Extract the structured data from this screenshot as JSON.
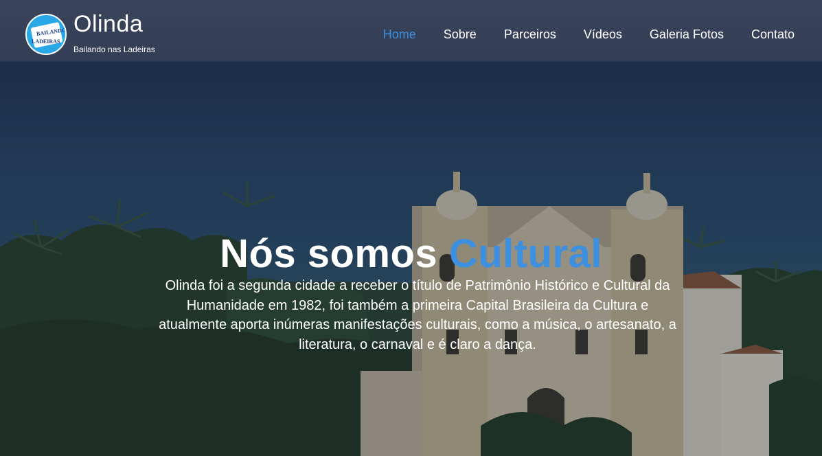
{
  "brand": {
    "title": "Olinda",
    "subtitle": "Bailando nas Ladeiras",
    "logo_text_top": "BAILANDO",
    "logo_text_bottom": "LADEIRAS"
  },
  "nav": {
    "items": [
      {
        "label": "Home",
        "active": true
      },
      {
        "label": "Sobre",
        "active": false
      },
      {
        "label": "Parceiros",
        "active": false
      },
      {
        "label": "Vídeos",
        "active": false
      },
      {
        "label": "Galeria Fotos",
        "active": false
      },
      {
        "label": "Contato",
        "active": false
      }
    ]
  },
  "hero": {
    "headline_main": "Nós somos ",
    "headline_accent": "Cultural",
    "paragraph": "Olinda foi a segunda cidade a receber o título de Patrimônio Histórico e Cultural da Humanidade em 1982, foi também a primeira Capital Brasileira da Cultura e atualmente aporta inúmeras manifestações culturais, como a música, o artesanato, a literatura, o carnaval e é claro a dança."
  },
  "colors": {
    "accent": "#3d8fe0",
    "navbar": "#3a445c",
    "logo_blue": "#29a8e8"
  }
}
